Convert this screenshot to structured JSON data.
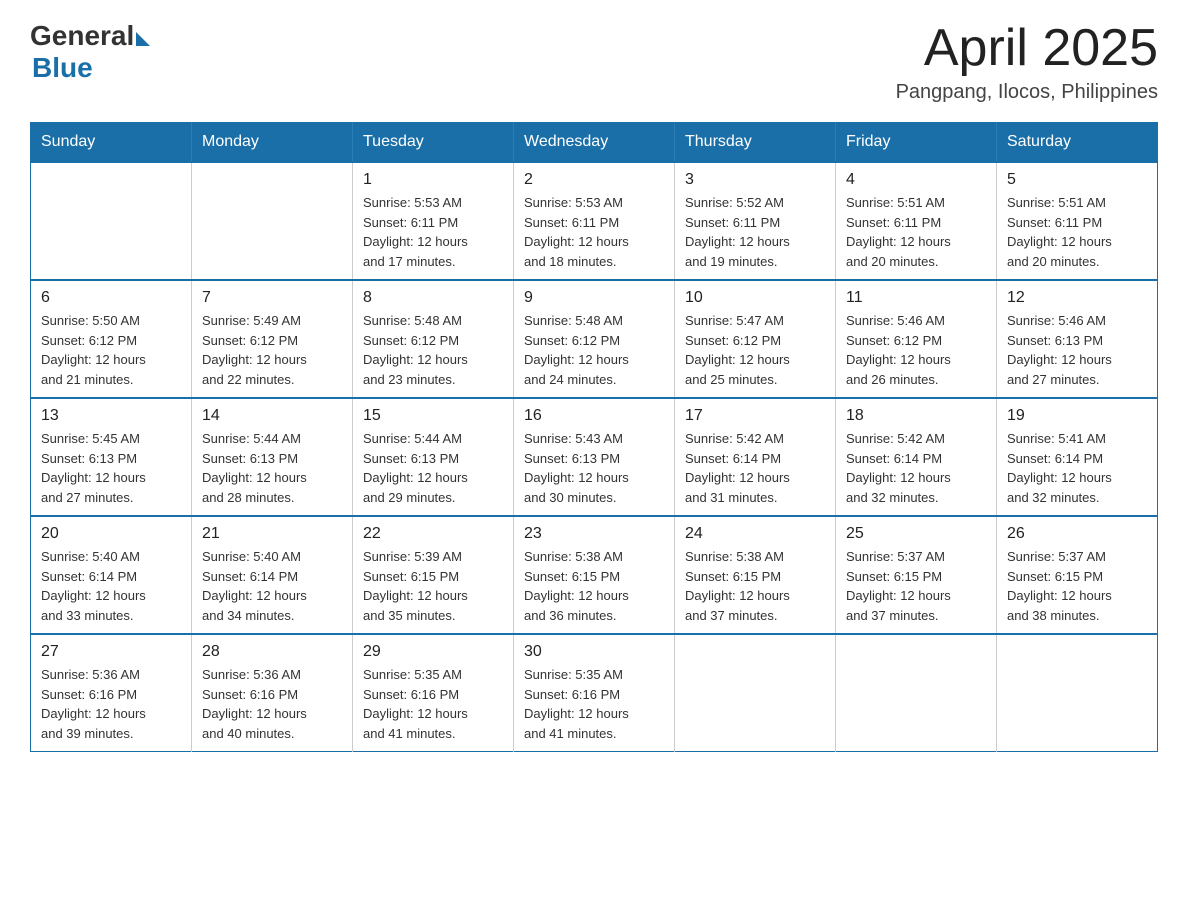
{
  "header": {
    "logo_general": "General",
    "logo_blue": "Blue",
    "month_year": "April 2025",
    "location": "Pangpang, Ilocos, Philippines"
  },
  "days_of_week": [
    "Sunday",
    "Monday",
    "Tuesday",
    "Wednesday",
    "Thursday",
    "Friday",
    "Saturday"
  ],
  "weeks": [
    [
      {
        "day": "",
        "info": ""
      },
      {
        "day": "",
        "info": ""
      },
      {
        "day": "1",
        "info": "Sunrise: 5:53 AM\nSunset: 6:11 PM\nDaylight: 12 hours\nand 17 minutes."
      },
      {
        "day": "2",
        "info": "Sunrise: 5:53 AM\nSunset: 6:11 PM\nDaylight: 12 hours\nand 18 minutes."
      },
      {
        "day": "3",
        "info": "Sunrise: 5:52 AM\nSunset: 6:11 PM\nDaylight: 12 hours\nand 19 minutes."
      },
      {
        "day": "4",
        "info": "Sunrise: 5:51 AM\nSunset: 6:11 PM\nDaylight: 12 hours\nand 20 minutes."
      },
      {
        "day": "5",
        "info": "Sunrise: 5:51 AM\nSunset: 6:11 PM\nDaylight: 12 hours\nand 20 minutes."
      }
    ],
    [
      {
        "day": "6",
        "info": "Sunrise: 5:50 AM\nSunset: 6:12 PM\nDaylight: 12 hours\nand 21 minutes."
      },
      {
        "day": "7",
        "info": "Sunrise: 5:49 AM\nSunset: 6:12 PM\nDaylight: 12 hours\nand 22 minutes."
      },
      {
        "day": "8",
        "info": "Sunrise: 5:48 AM\nSunset: 6:12 PM\nDaylight: 12 hours\nand 23 minutes."
      },
      {
        "day": "9",
        "info": "Sunrise: 5:48 AM\nSunset: 6:12 PM\nDaylight: 12 hours\nand 24 minutes."
      },
      {
        "day": "10",
        "info": "Sunrise: 5:47 AM\nSunset: 6:12 PM\nDaylight: 12 hours\nand 25 minutes."
      },
      {
        "day": "11",
        "info": "Sunrise: 5:46 AM\nSunset: 6:12 PM\nDaylight: 12 hours\nand 26 minutes."
      },
      {
        "day": "12",
        "info": "Sunrise: 5:46 AM\nSunset: 6:13 PM\nDaylight: 12 hours\nand 27 minutes."
      }
    ],
    [
      {
        "day": "13",
        "info": "Sunrise: 5:45 AM\nSunset: 6:13 PM\nDaylight: 12 hours\nand 27 minutes."
      },
      {
        "day": "14",
        "info": "Sunrise: 5:44 AM\nSunset: 6:13 PM\nDaylight: 12 hours\nand 28 minutes."
      },
      {
        "day": "15",
        "info": "Sunrise: 5:44 AM\nSunset: 6:13 PM\nDaylight: 12 hours\nand 29 minutes."
      },
      {
        "day": "16",
        "info": "Sunrise: 5:43 AM\nSunset: 6:13 PM\nDaylight: 12 hours\nand 30 minutes."
      },
      {
        "day": "17",
        "info": "Sunrise: 5:42 AM\nSunset: 6:14 PM\nDaylight: 12 hours\nand 31 minutes."
      },
      {
        "day": "18",
        "info": "Sunrise: 5:42 AM\nSunset: 6:14 PM\nDaylight: 12 hours\nand 32 minutes."
      },
      {
        "day": "19",
        "info": "Sunrise: 5:41 AM\nSunset: 6:14 PM\nDaylight: 12 hours\nand 32 minutes."
      }
    ],
    [
      {
        "day": "20",
        "info": "Sunrise: 5:40 AM\nSunset: 6:14 PM\nDaylight: 12 hours\nand 33 minutes."
      },
      {
        "day": "21",
        "info": "Sunrise: 5:40 AM\nSunset: 6:14 PM\nDaylight: 12 hours\nand 34 minutes."
      },
      {
        "day": "22",
        "info": "Sunrise: 5:39 AM\nSunset: 6:15 PM\nDaylight: 12 hours\nand 35 minutes."
      },
      {
        "day": "23",
        "info": "Sunrise: 5:38 AM\nSunset: 6:15 PM\nDaylight: 12 hours\nand 36 minutes."
      },
      {
        "day": "24",
        "info": "Sunrise: 5:38 AM\nSunset: 6:15 PM\nDaylight: 12 hours\nand 37 minutes."
      },
      {
        "day": "25",
        "info": "Sunrise: 5:37 AM\nSunset: 6:15 PM\nDaylight: 12 hours\nand 37 minutes."
      },
      {
        "day": "26",
        "info": "Sunrise: 5:37 AM\nSunset: 6:15 PM\nDaylight: 12 hours\nand 38 minutes."
      }
    ],
    [
      {
        "day": "27",
        "info": "Sunrise: 5:36 AM\nSunset: 6:16 PM\nDaylight: 12 hours\nand 39 minutes."
      },
      {
        "day": "28",
        "info": "Sunrise: 5:36 AM\nSunset: 6:16 PM\nDaylight: 12 hours\nand 40 minutes."
      },
      {
        "day": "29",
        "info": "Sunrise: 5:35 AM\nSunset: 6:16 PM\nDaylight: 12 hours\nand 41 minutes."
      },
      {
        "day": "30",
        "info": "Sunrise: 5:35 AM\nSunset: 6:16 PM\nDaylight: 12 hours\nand 41 minutes."
      },
      {
        "day": "",
        "info": ""
      },
      {
        "day": "",
        "info": ""
      },
      {
        "day": "",
        "info": ""
      }
    ]
  ]
}
